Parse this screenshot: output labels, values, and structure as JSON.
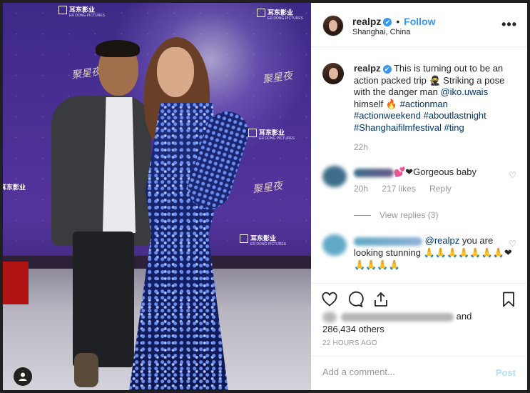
{
  "post": {
    "username": "realpz",
    "follow_label": "Follow",
    "location": "Shanghai, China",
    "more_glyph": "•••",
    "verified_glyph": "✔"
  },
  "caption": {
    "username": "realpz",
    "text_before": " This is turning out to be an action packed trip 🥷 Striking a pose with the danger man ",
    "mention": "@iko.uwais",
    "text_mid": " himself 🔥 ",
    "hashtags": [
      "#actionman",
      "#actionweekend",
      "#aboutlastnight",
      "#Shanghaifilmfestival",
      "#ting"
    ],
    "time": "22h"
  },
  "comments": [
    {
      "text": "💕❤Gorgeous baby",
      "time": "20h",
      "likes": "217 likes",
      "reply_label": "Reply",
      "blur_colors": [
        "#3e6e8a",
        "#6b5a8a"
      ]
    },
    {
      "mention": "@realpz",
      "text": " you are looking stunning 🙏🙏🙏🙏🙏🙏🙏❤🙏🙏🙏🙏",
      "blur_colors": [
        "#62a9c6",
        "#8fb0d6"
      ]
    }
  ],
  "view_replies": "View replies (3)",
  "likes": {
    "and_label": "and",
    "others": "286,434 others"
  },
  "timestamp": "22 HOURS AGO",
  "comment_box": {
    "placeholder": "Add a comment...",
    "post_label": "Post"
  },
  "photo_text": {
    "brand": "耳东影业",
    "brand_sub": "ER DONG PICTURES",
    "calligraphy": "聚星夜"
  },
  "colors": {
    "link": "#003569",
    "accent": "#3897f0",
    "muted": "#999999",
    "post_disabled": "#b2dffc"
  }
}
